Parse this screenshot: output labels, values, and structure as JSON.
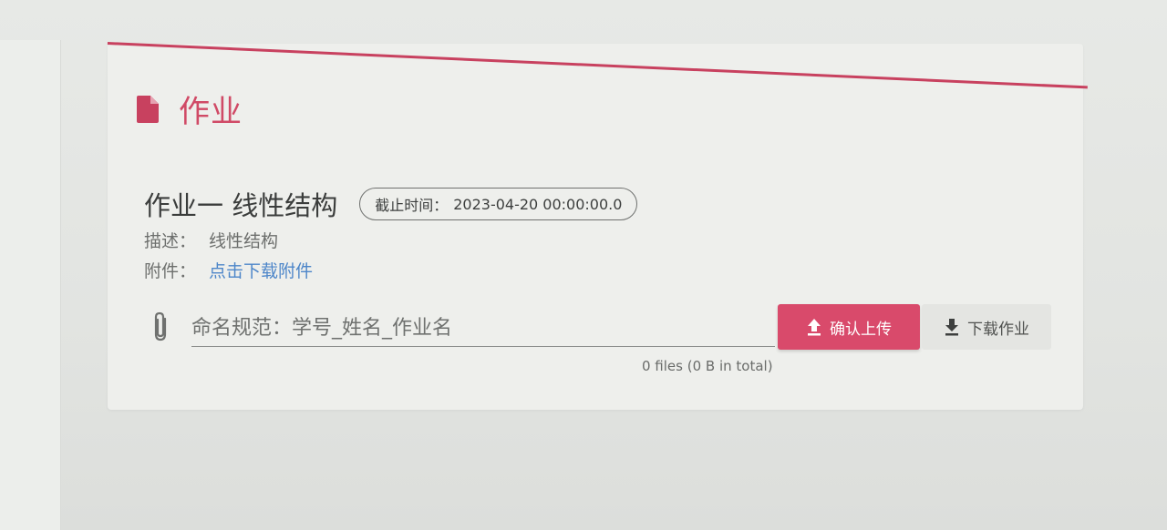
{
  "card": {
    "title": "作业",
    "accent_color": "#d04a66"
  },
  "homework": {
    "name": "作业一 线性结构",
    "deadline_label": "截止时间：",
    "deadline_value": "2023-04-20 00:00:00.0",
    "description_label": "描述：",
    "description_value": "线性结构",
    "attachment_label": "附件：",
    "attachment_link": "点击下载附件"
  },
  "upload": {
    "placeholder": "命名规范：学号_姓名_作业名",
    "value": "",
    "upload_button_label": "确认上传",
    "download_button_label": "下载作业",
    "file_count_text": "0 files (0 B in total)",
    "upload_button_color": "#d94a6b"
  },
  "icons": {
    "header": "document-icon",
    "input": "paperclip-icon",
    "upload": "upload-icon",
    "download": "download-icon"
  }
}
